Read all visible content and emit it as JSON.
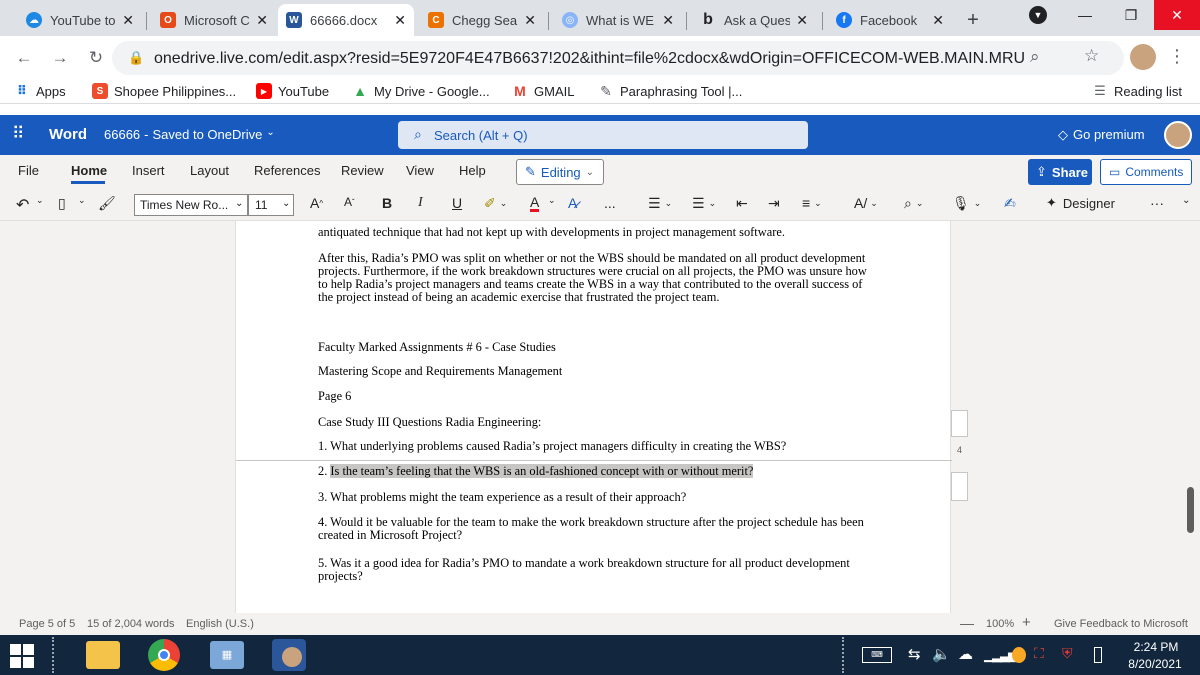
{
  "browser": {
    "tabs": [
      {
        "title": "YouTube to",
        "icon": "cloud-icon"
      },
      {
        "title": "Microsoft C",
        "icon": "office-icon"
      },
      {
        "title": "66666.docx",
        "icon": "word-icon",
        "active": true
      },
      {
        "title": "Chegg Sea",
        "icon": "chegg-icon"
      },
      {
        "title": "What is WE",
        "icon": "globe-icon"
      },
      {
        "title": "Ask a Ques",
        "icon": "bartleby-icon"
      },
      {
        "title": "Facebook",
        "icon": "facebook-icon"
      }
    ],
    "new_tab": "+",
    "url": "onedrive.live.com/edit.aspx?resid=5E9720F4E47B6637!202&ithint=file%2cdocx&wdOrigin=OFFICECOM-WEB.MAIN.MRU",
    "bookmarks": [
      {
        "label": "Apps",
        "icon": "apps-grid-icon"
      },
      {
        "label": "Shopee Philippines...",
        "icon": "shopee-icon"
      },
      {
        "label": "YouTube",
        "icon": "youtube-icon"
      },
      {
        "label": "My Drive - Google...",
        "icon": "drive-icon"
      },
      {
        "label": "GMAIL",
        "icon": "gmail-icon"
      },
      {
        "label": "Paraphrasing Tool |...",
        "icon": "quill-icon"
      }
    ],
    "reading_list": "Reading list"
  },
  "word": {
    "app_name": "Word",
    "doc_name": "66666",
    "save_status": "Saved to OneDrive",
    "search_placeholder": "Search (Alt + Q)",
    "go_premium": "Go premium",
    "ribbon_tabs": [
      "File",
      "Home",
      "Insert",
      "Layout",
      "References",
      "Review",
      "View",
      "Help"
    ],
    "active_tab": "Home",
    "editing_mode": "Editing",
    "share": "Share",
    "comments": "Comments",
    "font_name": "Times New Ro...",
    "font_size": "11",
    "grow_font": "A",
    "shrink_font": "A",
    "bold": "B",
    "italic": "I",
    "underline": "U",
    "more": "...",
    "designer": "Designer"
  },
  "document": {
    "para_top": "antiquated technique that had not kept up with developments in project management software.",
    "para_after": "After this, Radia’s PMO was split on whether or not the WBS should be mandated on all product development projects. Furthermore, if the work breakdown structures were crucial on all projects, the PMO was unsure how to help Radia’s project managers and teams create the WBS in a way that contributed to the overall success of the project instead of being an academic exercise that frustrated the project team.",
    "faculty": "Faculty Marked Assignments # 6 - Case Studies",
    "mastering": "Mastering Scope and Requirements Management",
    "page_label": "Page 6",
    "case_study": "Case Study III Questions Radia Engineering:",
    "q1": "1. What underlying problems caused Radia’s project managers difficulty in creating the WBS?",
    "q2_num": "2.",
    "q2_text": "Is the team’s feeling that the WBS is an old-fashioned concept with or without merit?",
    "q3": "3. What problems might the team experience as a result of their approach?",
    "q4": "4. Would it be valuable for the team to make the work breakdown structure after the project schedule has been created in Microsoft Project?",
    "q5": "5. Was it a good idea for Radia’s PMO to mandate a work breakdown structure for all product development projects?",
    "margin_page_num": "4"
  },
  "status": {
    "page": "Page 5 of 5",
    "words": "15 of 2,004 words",
    "language": "English (U.S.)",
    "zoom": "100%",
    "feedback": "Give Feedback to Microsoft"
  },
  "taskbar": {
    "time": "2:24 PM",
    "date": "8/20/2021"
  }
}
